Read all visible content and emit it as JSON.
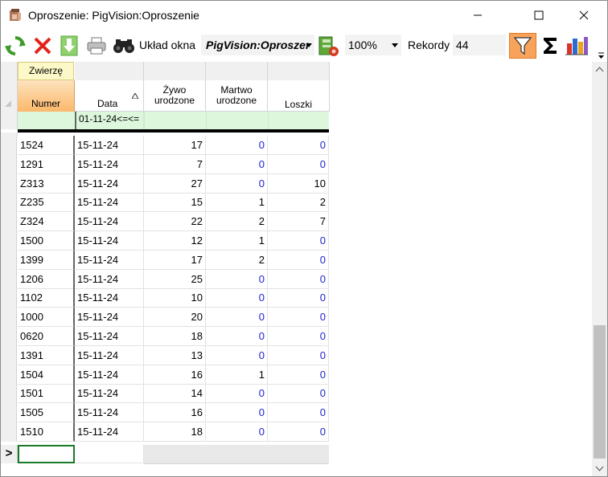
{
  "window": {
    "title": "Oproszenie: PigVision:Oproszenie"
  },
  "toolbar": {
    "layout_label": "Układ okna",
    "layout_value": "PigVision:Oproszeı",
    "zoom_value": "100%",
    "records_label": "Rekordy",
    "records_value": "44"
  },
  "grid": {
    "group_header": "Zwierzę",
    "columns": [
      "Numer",
      "Data",
      "Żywo urodzone",
      "Martwo urodzone",
      "Loszki"
    ],
    "col_zywo_l1": "Żywo",
    "col_zywo_l2": "urodzone",
    "col_martwo_l1": "Martwo",
    "col_martwo_l2": "urodzone",
    "filter_value": "01-11-24<=<=",
    "new_row_marker": ">",
    "rows": [
      [
        "1524",
        "15-11-24",
        "17",
        "0",
        "0"
      ],
      [
        "1291",
        "15-11-24",
        "7",
        "0",
        "0"
      ],
      [
        "Z313",
        "15-11-24",
        "27",
        "0",
        "10"
      ],
      [
        "Z235",
        "15-11-24",
        "15",
        "1",
        "2"
      ],
      [
        "Z324",
        "15-11-24",
        "22",
        "2",
        "7"
      ],
      [
        "1500",
        "15-11-24",
        "12",
        "1",
        "0"
      ],
      [
        "1399",
        "15-11-24",
        "17",
        "2",
        "0"
      ],
      [
        "1206",
        "15-11-24",
        "25",
        "0",
        "0"
      ],
      [
        "1102",
        "15-11-24",
        "10",
        "0",
        "0"
      ],
      [
        "1000",
        "15-11-24",
        "20",
        "0",
        "0"
      ],
      [
        "0620",
        "15-11-24",
        "18",
        "0",
        "0"
      ],
      [
        "1391",
        "15-11-24",
        "13",
        "0",
        "0"
      ],
      [
        "1504",
        "15-11-24",
        "16",
        "1",
        "0"
      ],
      [
        "1501",
        "15-11-24",
        "14",
        "0",
        "0"
      ],
      [
        "1505",
        "15-11-24",
        "16",
        "0",
        "0"
      ],
      [
        "1510",
        "15-11-24",
        "18",
        "0",
        "0"
      ]
    ]
  },
  "colors": {
    "zero_value": "#1f1fcf",
    "header_orange": "#fbc98a",
    "group_header_bg": "#fdf8c8",
    "filter_row_bg": "#ddf7dd",
    "filter_button_active": "#f7a35c"
  }
}
